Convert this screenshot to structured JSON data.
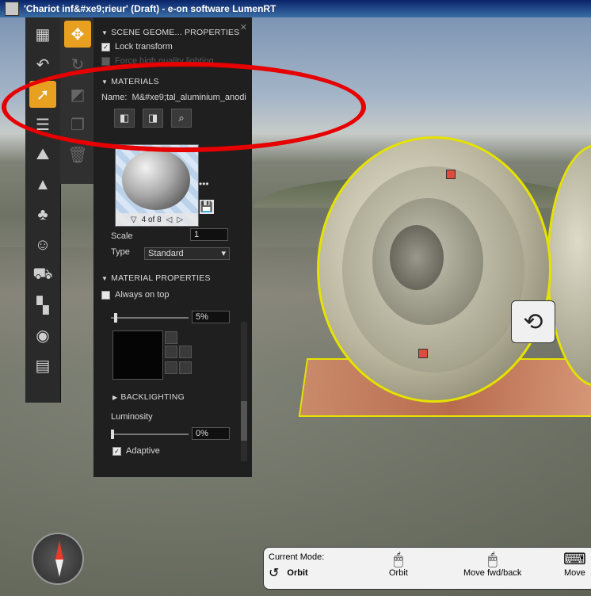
{
  "window": {
    "title": "'Chariot inf&#xe9;rieur' (Draft) - e-on software LumenRT"
  },
  "toolbar_left": {
    "items": [
      "building-icon",
      "undo-icon",
      "select-icon",
      "sliders-icon",
      "landscape-icon",
      "mountain-icon",
      "tree-icon",
      "person-icon",
      "car-icon",
      "blocks-icon",
      "camera-icon",
      "clapper-icon"
    ]
  },
  "panel": {
    "scene_header": "SCENE GEOME... PROPERTIES",
    "lock_transform": "Lock transform",
    "high_quality": "Force high quality lighting",
    "materials_header": "MATERIALS",
    "name_label": "Name:",
    "name_value": "M&#xe9;tal_aluminium_anodi",
    "preview_nav": "4 of 8",
    "more": "•••",
    "scale_label": "Scale",
    "scale_value": "1",
    "type_label": "Type",
    "type_value": "Standard",
    "mat_props_header": "MATERIAL PROPERTIES",
    "always_on_top": "Always on top",
    "opacity_value": "5%",
    "backlighting_header": "BACKLIGHTING",
    "luminosity_label": "Luminosity",
    "luminosity_value": "0%",
    "adaptive_label": "Adaptive"
  },
  "modebar": {
    "current_mode_label": "Current Mode:",
    "current_mode_value": "Orbit",
    "orbit_label": "Orbit",
    "move_fwd_label": "Move fwd/back",
    "move_label": "Move"
  },
  "colors": {
    "accent": "#e8a020",
    "selection_outline": "#e6e200",
    "annotation": "#e60000"
  }
}
